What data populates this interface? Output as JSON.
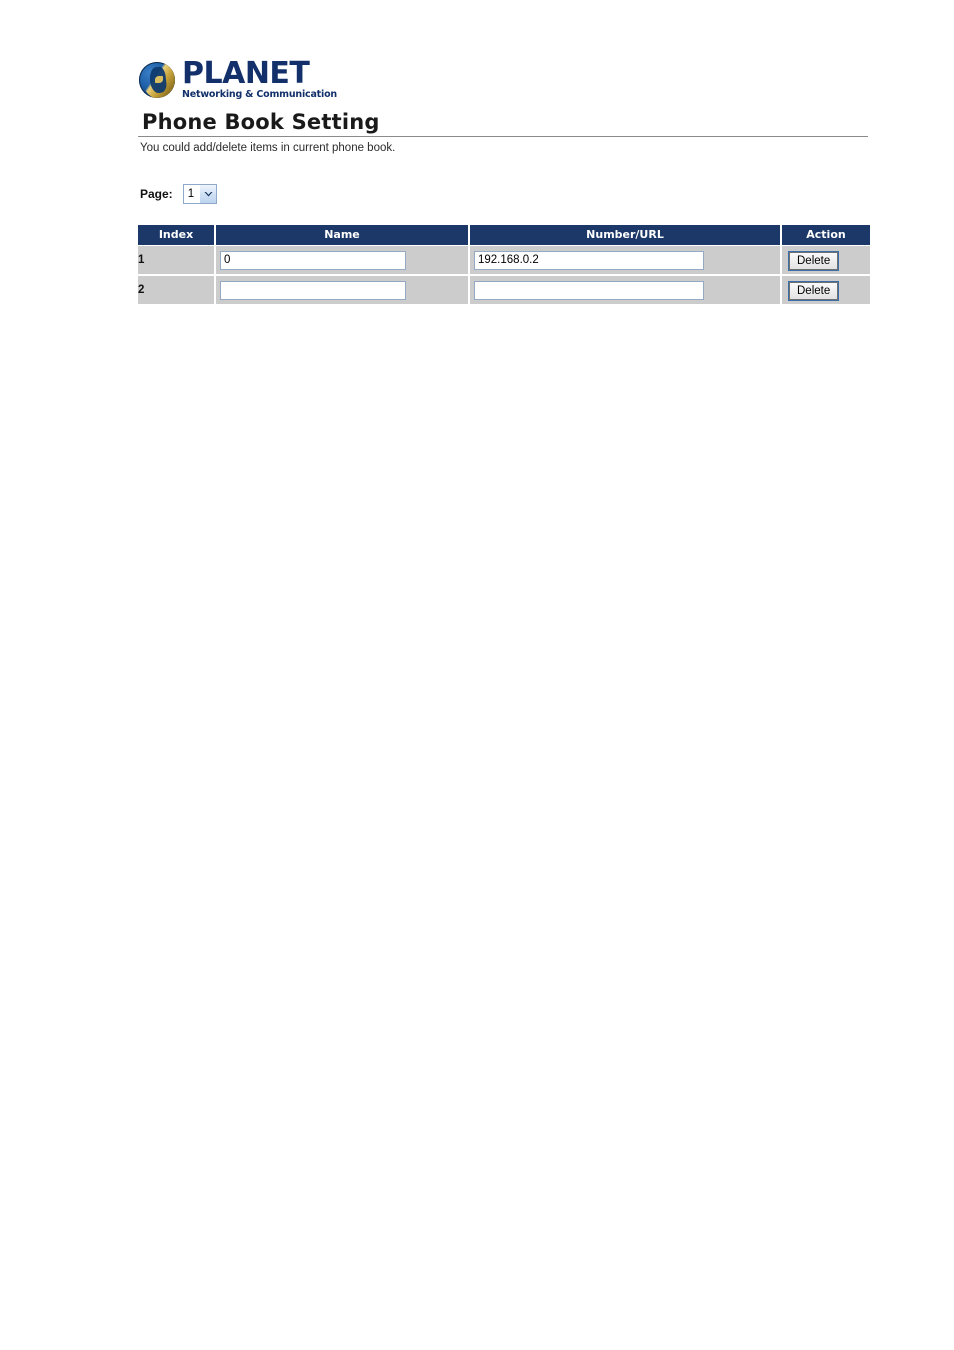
{
  "brand": {
    "name": "PLANET",
    "tagline": "Networking & Communication",
    "logo_icon": "planet-globe-icon",
    "brand_color": "#13306b"
  },
  "header": {
    "title": "Phone Book Setting",
    "description": "You could add/delete items in current phone book."
  },
  "pager": {
    "label": "Page:",
    "selected": "1",
    "options": [
      "1"
    ],
    "arrow_icon": "chevron-down-icon"
  },
  "table": {
    "columns": [
      "Index",
      "Name",
      "Number/URL",
      "Action"
    ],
    "header_bg": "#1b3868",
    "row_bg": "#cccccc",
    "rows": [
      {
        "index": "1",
        "name_value": "0",
        "name_placeholder": "",
        "number_value": "192.168.0.2",
        "number_placeholder": "",
        "action_label": "Delete"
      },
      {
        "index": "2",
        "name_value": "",
        "name_placeholder": "",
        "number_value": "",
        "number_placeholder": "",
        "action_label": "Delete"
      }
    ]
  }
}
